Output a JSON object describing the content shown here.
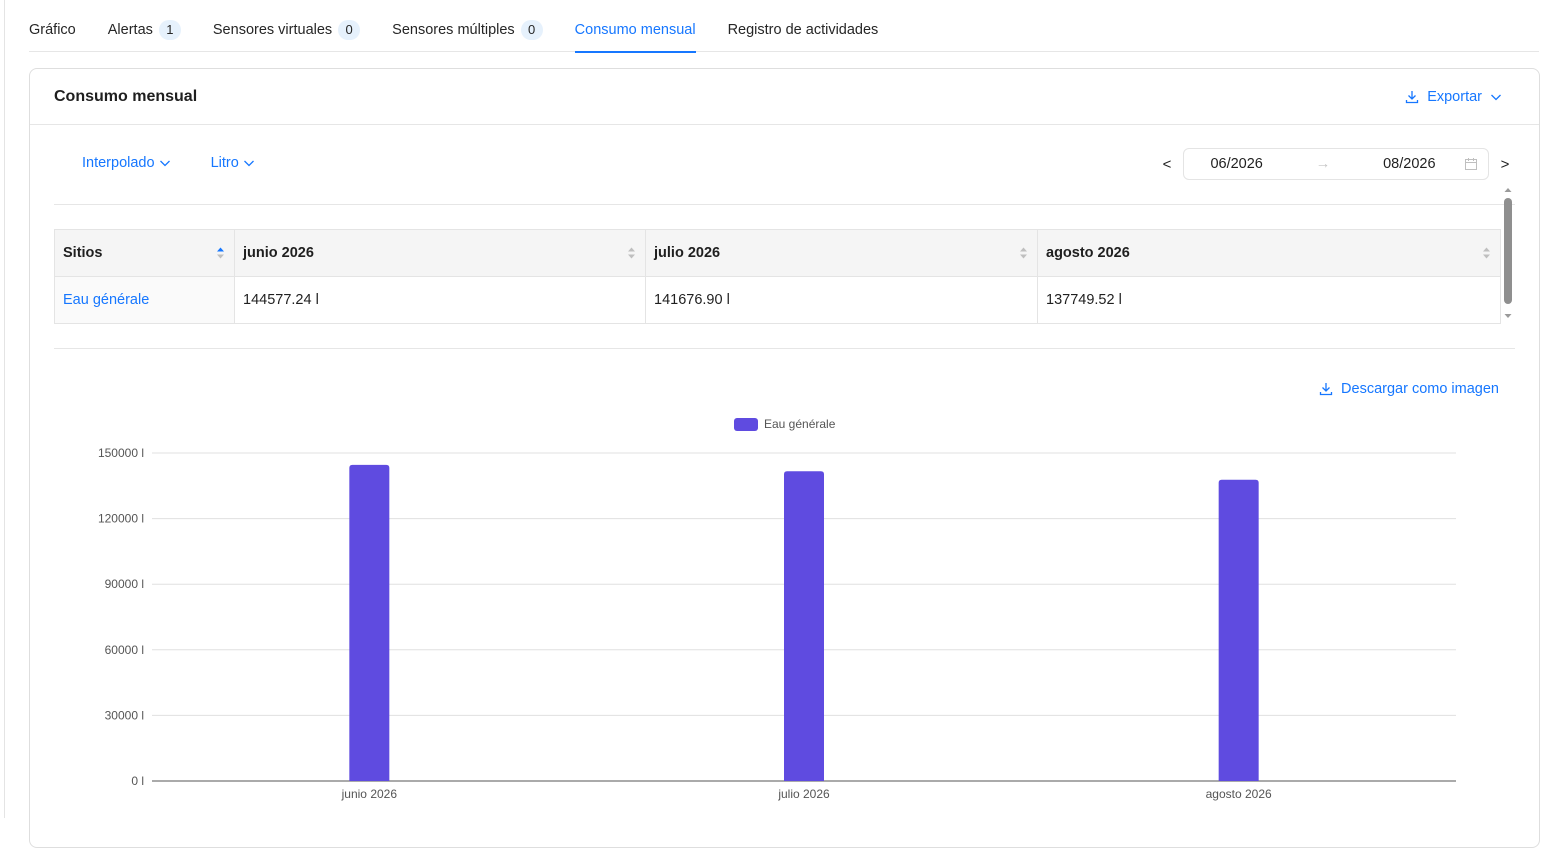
{
  "tabs": [
    {
      "label": "Gráfico",
      "count": null,
      "active": false
    },
    {
      "label": "Alertas",
      "count": "1",
      "active": false
    },
    {
      "label": "Sensores virtuales",
      "count": "0",
      "active": false
    },
    {
      "label": "Sensores múltiples",
      "count": "0",
      "active": false
    },
    {
      "label": "Consumo mensual",
      "count": null,
      "active": true
    },
    {
      "label": "Registro de actividades",
      "count": null,
      "active": false
    }
  ],
  "card": {
    "title": "Consumo mensual",
    "export_label": "Exportar"
  },
  "filters": {
    "mode": "Interpolado",
    "unit": "Litro"
  },
  "range": {
    "prev": "<",
    "next": ">",
    "start": "06/2026",
    "end": "08/2026",
    "separator": "→"
  },
  "table": {
    "headers": [
      "Sitios",
      "junio 2026",
      "julio 2026",
      "agosto 2026"
    ],
    "rows": [
      [
        "Eau générale",
        "144577.24 l",
        "141676.90 l",
        "137749.52 l"
      ]
    ]
  },
  "download_label": "Descargar como imagen",
  "colors": {
    "accent": "#1677ff",
    "bar": "#5f4be0"
  },
  "chart_data": {
    "type": "bar",
    "categories": [
      "junio 2026",
      "julio 2026",
      "agosto 2026"
    ],
    "series": [
      {
        "name": "Eau générale",
        "values": [
          144577.24,
          141676.9,
          137749.52
        ]
      }
    ],
    "ylim": [
      0,
      150000
    ],
    "yticks": [
      "0 l",
      "30000 l",
      "60000 l",
      "90000 l",
      "120000 l",
      "150000 l"
    ],
    "legend": "top-center",
    "grid": true
  }
}
